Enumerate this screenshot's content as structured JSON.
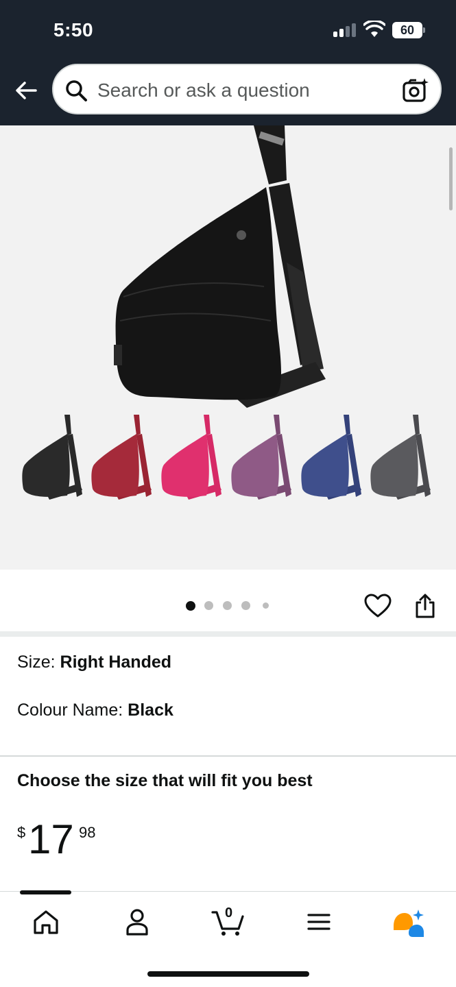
{
  "status_bar": {
    "time": "5:50",
    "battery": "60"
  },
  "search": {
    "placeholder": "Search or ask a question"
  },
  "product": {
    "size_label": "Size: ",
    "size_value": "Right Handed",
    "colour_label": "Colour Name: ",
    "colour_value": "Black",
    "fit_heading": "Choose the size that will fit you best",
    "price": {
      "currency": "$",
      "whole": "17",
      "fraction": "98"
    }
  },
  "gallery": {
    "variants": [
      {
        "name": "black",
        "color": "#2a2a2a"
      },
      {
        "name": "wine",
        "color": "#9a2433"
      },
      {
        "name": "pink",
        "color": "#e0306e"
      },
      {
        "name": "mauve",
        "color": "#8f5a86"
      },
      {
        "name": "navy",
        "color": "#3f4f8c"
      },
      {
        "name": "grey",
        "color": "#5a5a5e"
      }
    ],
    "dots": {
      "count": 5,
      "active_index": 0
    }
  },
  "tabbar": {
    "tabs": [
      "home-icon",
      "account-icon",
      "cart-icon",
      "menu-icon",
      "rufus-icon"
    ],
    "cart_count": "0"
  },
  "colors": {
    "header_bg": "#1b232e",
    "accent_orange": "#ff9900",
    "accent_blue": "#1e88e5"
  }
}
